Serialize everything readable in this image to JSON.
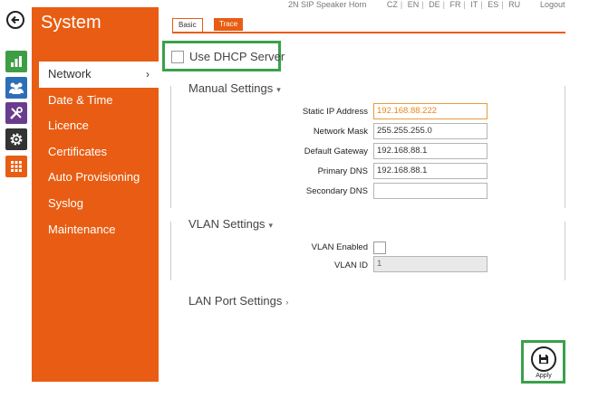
{
  "topbar": {
    "product": "2N SIP Speaker Horn",
    "languages": [
      "CZ",
      "EN",
      "DE",
      "FR",
      "IT",
      "ES",
      "RU"
    ],
    "logout": "Logout"
  },
  "sidebar": {
    "title": "System",
    "items": [
      {
        "label": "Network",
        "active": true
      },
      {
        "label": "Date & Time"
      },
      {
        "label": "Licence"
      },
      {
        "label": "Certificates"
      },
      {
        "label": "Auto Provisioning"
      },
      {
        "label": "Syslog"
      },
      {
        "label": "Maintenance"
      }
    ],
    "active_chevron": "›"
  },
  "icons": {
    "back": "back-arrow-icon",
    "status": "bar-chart-icon",
    "users": "users-icon",
    "tools": "tools-icon",
    "settings": "gear-icon",
    "apps": "grid-icon"
  },
  "tabs": [
    {
      "label": "Basic",
      "active": true
    },
    {
      "label": "Trace",
      "active": false
    }
  ],
  "dhcp": {
    "label": "Use DHCP Server",
    "checked": false
  },
  "manual_settings": {
    "title": "Manual Settings",
    "fields": [
      {
        "label": "Static IP Address",
        "value": "192.168.88.222"
      },
      {
        "label": "Network Mask",
        "value": "255.255.255.0"
      },
      {
        "label": "Default Gateway",
        "value": "192.168.88.1"
      },
      {
        "label": "Primary DNS",
        "value": "192.168.88.1"
      },
      {
        "label": "Secondary DNS",
        "value": ""
      }
    ]
  },
  "vlan_settings": {
    "title": "VLAN Settings",
    "enabled_label": "VLAN Enabled",
    "enabled": false,
    "id_label": "VLAN ID",
    "id_value": "1"
  },
  "lan_port": {
    "title": "LAN Port Settings"
  },
  "apply": {
    "label": "Apply"
  },
  "colors": {
    "accent": "#e85d13",
    "highlight": "#3aa14a",
    "focus": "#e89b3a"
  }
}
